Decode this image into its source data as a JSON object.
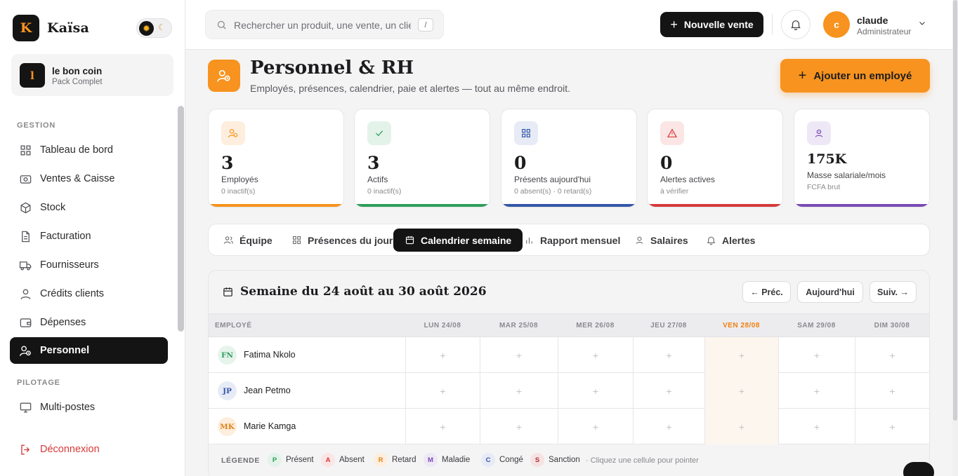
{
  "brand": {
    "logo_letter": "K",
    "name": "Kaïsa"
  },
  "theme": {
    "sun_icon": "sun-icon",
    "moon_icon": "moon-icon"
  },
  "shop": {
    "avatar_letter": "l",
    "name": "le bon coin",
    "plan": "Pack Complet"
  },
  "nav": {
    "section_gestion": "GESTION",
    "section_pilotage": "PILOTAGE",
    "items": [
      {
        "label": "Tableau de bord",
        "icon": "grid-icon"
      },
      {
        "label": "Ventes & Caisse",
        "icon": "cash-register-icon"
      },
      {
        "label": "Stock",
        "icon": "box-icon"
      },
      {
        "label": "Facturation",
        "icon": "document-icon"
      },
      {
        "label": "Fournisseurs",
        "icon": "truck-icon"
      },
      {
        "label": "Crédits clients",
        "icon": "user-icon"
      },
      {
        "label": "Dépenses",
        "icon": "wallet-icon"
      },
      {
        "label": "Personnel",
        "icon": "staff-icon",
        "active": true
      }
    ],
    "pilotage_items": [
      {
        "label": "Multi-postes",
        "icon": "monitor-icon"
      }
    ],
    "logout": "Déconnexion"
  },
  "topbar": {
    "search_placeholder": "Rechercher un produit, une vente, un client...",
    "search_shortcut": "/",
    "new_sale": "Nouvelle vente",
    "user": {
      "initial": "c",
      "name": "claude",
      "role": "Administrateur"
    }
  },
  "header": {
    "title": "Personnel & RH",
    "subtitle": "Employés, présences, calendrier, paie et alertes — tout au même endroit.",
    "add_button": "Ajouter un employé"
  },
  "stats": [
    {
      "value": "3",
      "label": "Employés",
      "sub": "0 inactif(s)",
      "color": "#f7931e",
      "icon": "staff-icon"
    },
    {
      "value": "3",
      "label": "Actifs",
      "sub": "0 inactif(s)",
      "color": "#2e9e5b",
      "icon": "check-icon"
    },
    {
      "value": "0",
      "label": "Présents aujourd'hui",
      "sub": "0 absent(s) · 0 retard(s)",
      "color": "#3556a8",
      "icon": "grid-icon"
    },
    {
      "value": "0",
      "label": "Alertes actives",
      "sub": "à vérifier",
      "color": "#d63a3a",
      "icon": "warning-icon"
    },
    {
      "value": "175K",
      "label": "Masse salariale/mois",
      "sub": "FCFA brut",
      "color": "#7b4bb3",
      "icon": "payroll-icon"
    }
  ],
  "tabs": [
    {
      "label": "Équipe",
      "icon": "team-icon"
    },
    {
      "label": "Présences du jour",
      "icon": "grid-icon"
    },
    {
      "label": "Calendrier semaine",
      "icon": "calendar-icon",
      "active": true
    },
    {
      "label": "Rapport mensuel",
      "icon": "bar-chart-icon"
    },
    {
      "label": "Salaires",
      "icon": "payroll-icon"
    },
    {
      "label": "Alertes",
      "icon": "bell-icon"
    }
  ],
  "calendar": {
    "title": "Semaine du 24 août au 30 août 2026",
    "prev": "← Préc.",
    "today": "Aujourd'hui",
    "next": "Suiv. →",
    "employee_col": "EMPLOYÉ",
    "days": [
      "LUN 24/08",
      "MAR 25/08",
      "MER 26/08",
      "JEU 27/08",
      "VEN 28/08",
      "SAM 29/08",
      "DIM 30/08"
    ],
    "today_index": 4,
    "cell_placeholder": "+",
    "employees": [
      {
        "initials": "FN",
        "name": "Fatima Nkolo",
        "bg": "#e6f4ec",
        "fg": "#2e9e5b"
      },
      {
        "initials": "JP",
        "name": "Jean Petmo",
        "bg": "#e7ebf6",
        "fg": "#3556a8"
      },
      {
        "initials": "MK",
        "name": "Marie Kamga",
        "bg": "#fdeedd",
        "fg": "#e0811a"
      }
    ],
    "legend_title": "LÉGENDE",
    "legend": [
      {
        "code": "P",
        "label": "Présent",
        "bg": "#e3f3e9",
        "fg": "#2e9e5b"
      },
      {
        "code": "A",
        "label": "Absent",
        "bg": "#fbe5e5",
        "fg": "#d63a3a"
      },
      {
        "code": "R",
        "label": "Retard",
        "bg": "#fdeedd",
        "fg": "#e0811a"
      },
      {
        "code": "M",
        "label": "Maladie",
        "bg": "#eee8f6",
        "fg": "#7b4bb3"
      },
      {
        "code": "C",
        "label": "Congé",
        "bg": "#e7ebf6",
        "fg": "#3556a8"
      },
      {
        "code": "S",
        "label": "Sanction",
        "bg": "#f6e2e2",
        "fg": "#a83232"
      }
    ],
    "legend_note": "· Cliquez une cellule pour pointer"
  }
}
